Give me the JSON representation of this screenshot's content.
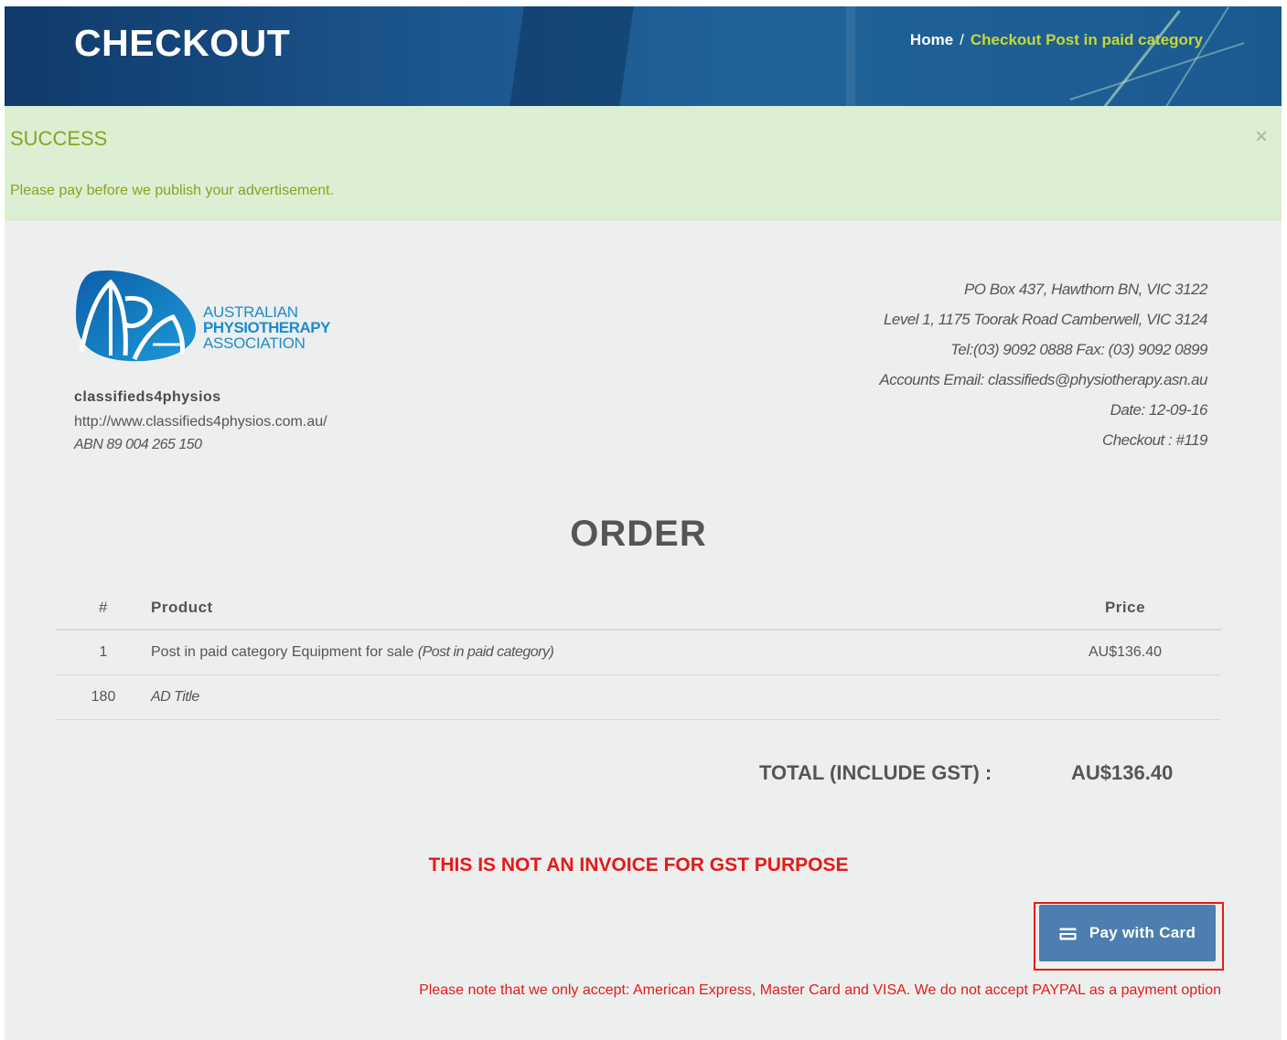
{
  "header": {
    "title": "CHECKOUT",
    "breadcrumb": {
      "home": "Home",
      "separator": "/",
      "current": "Checkout Post in paid category"
    }
  },
  "alert": {
    "title": "SUCCESS",
    "message": "Please pay before we publish your advertisement.",
    "close": "×"
  },
  "logo": {
    "line1": "AUSTRALIAN",
    "line2": "PHYSIOTHERAPY",
    "line3": "ASSOCIATION"
  },
  "company": {
    "name": "classifieds4physios",
    "url": "http://www.classifieds4physios.com.au/",
    "abn": "ABN 89 004 265 150"
  },
  "address": {
    "po_box": "PO Box 437, Hawthorn BN, VIC 3122",
    "street": "Level 1, 1175 Toorak Road Camberwell, VIC 3124",
    "phone": "Tel:(03) 9092 0888 Fax: (03) 9092 0899",
    "email": "Accounts Email: classifieds@physiotherapy.asn.au",
    "date": "Date: 12-09-16",
    "checkout": "Checkout : #119"
  },
  "order": {
    "heading": "ORDER",
    "columns": {
      "num": "#",
      "product": "Product",
      "price": "Price"
    },
    "rows": [
      {
        "num": "1",
        "product": "Post in paid category Equipment for sale",
        "product_note": "(Post in paid category)",
        "price": "AU$136.40"
      },
      {
        "num": "180",
        "product_note": "AD Title"
      }
    ],
    "total_label": "TOTAL (INCLUDE GST) :",
    "total_value": "AU$136.40"
  },
  "gst_notice": "THIS IS NOT AN INVOICE FOR GST PURPOSE",
  "pay_button": {
    "label": "Pay with Card",
    "icon": "credit-card-icon"
  },
  "payment_note": "Please note that we only accept: American Express, Master Card and VISA. We do not accept PAYPAL as a payment option",
  "colors": {
    "header_blue": "#1c5790",
    "breadcrumb_active": "#c4d838",
    "alert_bg": "#dcefd2",
    "alert_text": "#8ca024",
    "logo_blue": "#1c8bd0",
    "button_blue": "#4d7eaf",
    "notice_red": "#e41a1a"
  }
}
